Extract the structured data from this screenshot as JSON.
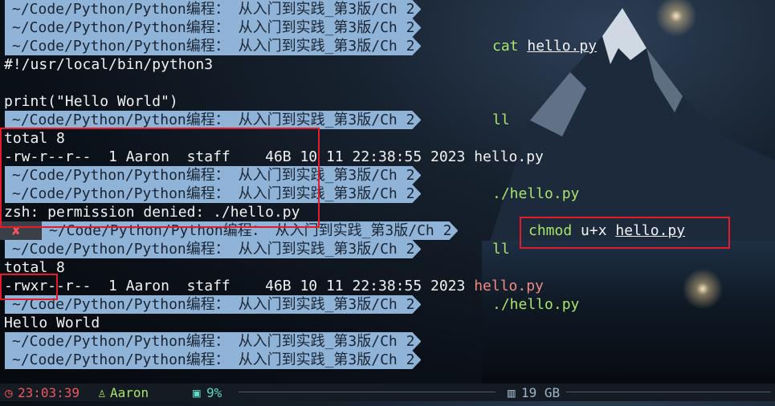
{
  "prompt_path": "~/Code/Python/Python编程： 从入门到实践_第3版/Ch 2",
  "lines": {
    "l0": {
      "prompt": "~/Code/Python/Python编程： 从入门到实践_第3版/Ch 2"
    },
    "l1": {
      "prompt": "~/Code/Python/Python编程： 从入门到实践_第3版/Ch 2"
    },
    "l2": {
      "prompt": "~/Code/Python/Python编程： 从入门到实践_第3版/Ch 2",
      "cmd": "cat",
      "arg": "hello.py"
    },
    "l3": {
      "text": "#!/usr/local/bin/python3"
    },
    "l5": {
      "text": "print(\"Hello World\")"
    },
    "l6": {
      "prompt": "~/Code/Python/Python编程： 从入门到实践_第3版/Ch 2",
      "cmd": "ll"
    },
    "l7": {
      "text": "total 8"
    },
    "l8": {
      "text": "-rw-r--r--  1 Aaron  staff    46B 10 11 22:38:55 2023 hello.py"
    },
    "l9": {
      "prompt": "~/Code/Python/Python编程： 从入门到实践_第3版/Ch 2"
    },
    "l10": {
      "prompt": "~/Code/Python/Python编程： 从入门到实践_第3版/Ch 2",
      "cmd": "./hello.py"
    },
    "l11": {
      "text": "zsh: permission denied: ./hello.py"
    },
    "l12": {
      "error_mark": "✘",
      "prompt": "~/Code/Python/Python编程： 从入门到实践_第3版/Ch 2",
      "cmd": "chmod",
      "cmd_rest": "u+x",
      "arg": "hello.py"
    },
    "l13": {
      "prompt": "~/Code/Python/Python编程： 从入门到实践_第3版/Ch 2",
      "cmd": "ll"
    },
    "l14": {
      "text": "total 8"
    },
    "l15": {
      "text": "-rwxr--r--  1 Aaron  staff    46B 10 11 22:38:55 2023 ",
      "file": "hello.py"
    },
    "l16": {
      "prompt": "~/Code/Python/Python编程： 从入门到实践_第3版/Ch 2",
      "cmd": "./hello.py"
    },
    "l17": {
      "text": "Hello World"
    },
    "l18": {
      "prompt": "~/Code/Python/Python编程： 从入门到实践_第3版/Ch 2"
    },
    "l19": {
      "prompt": "~/Code/Python/Python编程： 从入门到实践_第3版/Ch 2"
    }
  },
  "status_bar": {
    "time": "23:03:39",
    "user": "Aaron",
    "cpu": "9%",
    "memory": "19 GB"
  },
  "colors": {
    "prompt_bg": "#8fb4d8",
    "command": "#a8e36a",
    "highlight": "#e21b2d",
    "error": "#f0575c"
  }
}
